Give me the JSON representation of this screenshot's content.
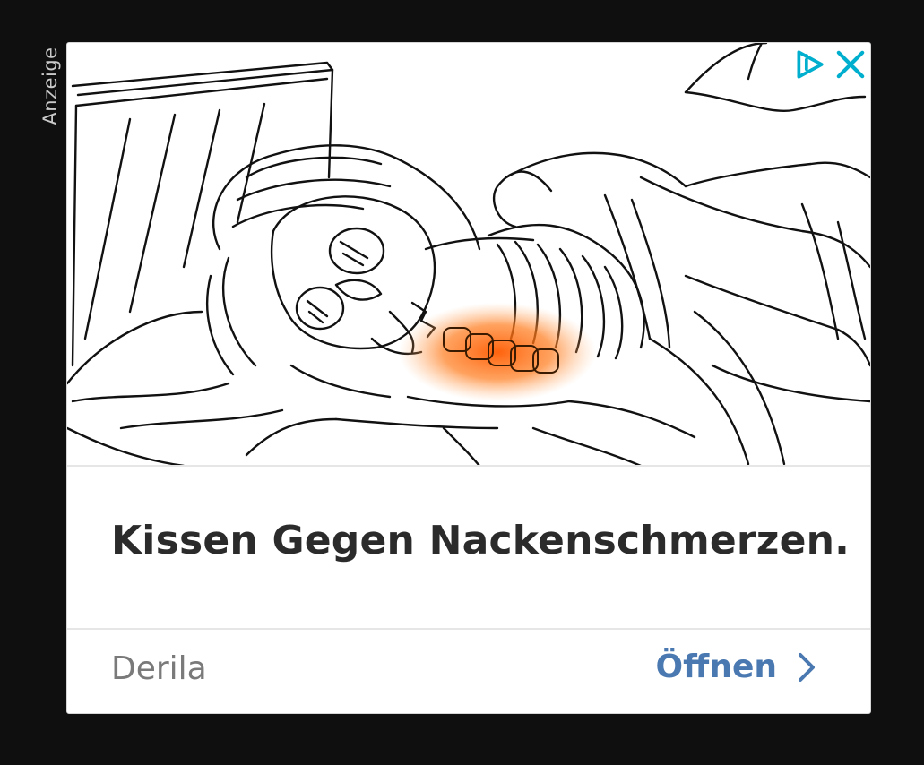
{
  "ad_label": "Anzeige",
  "headline": "Kissen Gegen Nackenschmerzen.",
  "advertiser": "Derila",
  "cta_label": "Öffnen",
  "icons": {
    "adchoices": "adchoices-icon",
    "close": "close-icon",
    "chevron": "chevron-right-icon"
  },
  "colors": {
    "background": "#0f0f0f",
    "card": "#ffffff",
    "headline": "#2b2b2b",
    "advertiser": "#7a7a7a",
    "cta": "#4a78b0",
    "adchoices": "#00aecd",
    "highlight": "#ff6a00"
  }
}
